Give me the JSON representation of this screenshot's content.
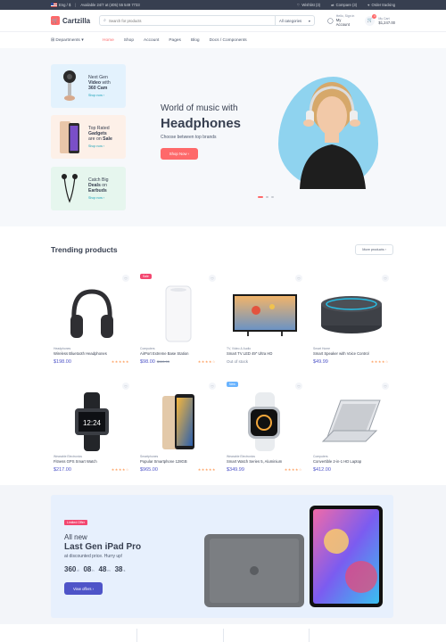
{
  "topbar": {
    "locale": "Eng / $",
    "phone_text": "Available 24/7 at (405) 55 549 7733",
    "wishlist": "Wishlist (3)",
    "compare": "Compare (3)",
    "order_tracking": "Order tracking"
  },
  "header": {
    "logo_text": "Cartzilla",
    "search_placeholder": "Search for products",
    "category_select": "All categories",
    "account_line1": "Hello, Sign in",
    "account_line2": "My Account",
    "cart_badge": "4",
    "cart_line1": "My Cart",
    "cart_total": "$1,247.00"
  },
  "nav": {
    "departments": "Departments",
    "items": [
      "Home",
      "Shop",
      "Account",
      "Pages",
      "Blog",
      "Docs / Components"
    ]
  },
  "hero": {
    "promos": [
      {
        "line1": "Next Gen",
        "bold": "Video",
        "line2_rest": " with",
        "bold2": "360 Cam",
        "cta": "Shop now ›"
      },
      {
        "line1": "Top Rated",
        "bold": "Gadgets",
        "line2_rest": "are on ",
        "bold2": "Sale",
        "cta": "Shop now ›"
      },
      {
        "line1": "Catch Big",
        "bold": "Deals",
        "line2_rest": " on",
        "bold2": "Earbuds",
        "cta": "Shop now ›"
      }
    ],
    "title_line1": "World of music with",
    "title_line2": "Headphones",
    "subtitle": "Choose between top brands",
    "cta": "Shop Now ›"
  },
  "trending": {
    "title": "Trending products",
    "more_label": "More products ›",
    "products": [
      {
        "category": "Headphones",
        "name": "Wireless Bluetooth Headphones",
        "price": "$198.00",
        "old_price": "",
        "tag": "",
        "stars": "★★★★★",
        "status": ""
      },
      {
        "category": "Computers",
        "name": "AirPort Extreme Base Station",
        "price": "$98.00",
        "old_price": "$119.99",
        "tag": "Sale",
        "stars": "★★★★☆",
        "status": ""
      },
      {
        "category": "TV, Video & Audio",
        "name": "Smart TV LED 49\" Ultra HD",
        "price": "",
        "old_price": "",
        "tag": "",
        "stars": "",
        "status": "Out of stock"
      },
      {
        "category": "Smart Home",
        "name": "Smart Speaker with Voice Control",
        "price": "$49.99",
        "old_price": "",
        "tag": "",
        "stars": "★★★★☆",
        "status": ""
      },
      {
        "category": "Wearable Electronics",
        "name": "Fitness GPS Smart Watch",
        "price": "$217.00",
        "old_price": "",
        "tag": "",
        "stars": "★★★★☆",
        "status": ""
      },
      {
        "category": "Smartphones",
        "name": "Popular Smartphone 128GB",
        "price": "$965.00",
        "old_price": "",
        "tag": "",
        "stars": "★★★★★",
        "status": ""
      },
      {
        "category": "Wearable Electronics",
        "name": "Smart Watch Series 5, Aluminium",
        "price": "$349.99",
        "old_price": "",
        "tag": "New",
        "stars": "★★★★☆",
        "status": ""
      },
      {
        "category": "Computers",
        "name": "Convertible 2-in-1 HD Laptop",
        "price": "$412.00",
        "old_price": "",
        "tag": "",
        "stars": "",
        "status": ""
      }
    ]
  },
  "banner": {
    "badge": "Limited Offer",
    "line1": "All new",
    "line2": "Last Gen iPad Pro",
    "line3": "at discounted price. Hurry up!",
    "countdown": [
      {
        "value": "360",
        "unit": "d"
      },
      {
        "value": "08",
        "unit": "h"
      },
      {
        "value": "48",
        "unit": "m"
      },
      {
        "value": "38",
        "unit": "s"
      }
    ],
    "cta": "View offers ›"
  },
  "colors": {
    "accent": "#fe696a",
    "primary": "#4e54c8",
    "dark": "#373f50",
    "hero_bg": "#f6f8fb"
  }
}
